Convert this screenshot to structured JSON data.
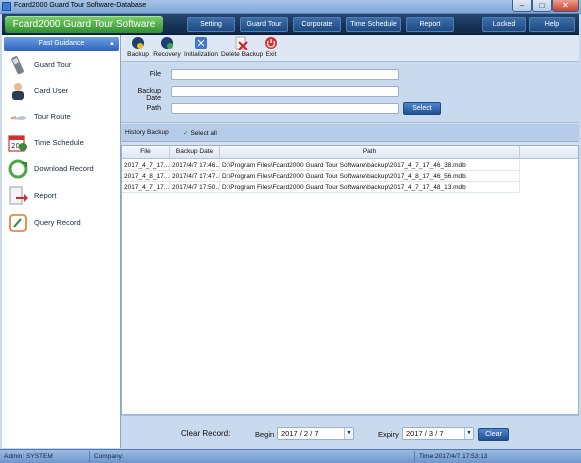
{
  "window": {
    "title": "Fcard2000 Guard Tour Software-Database"
  },
  "menubar": {
    "brand": "Fcard2000 Guard Tour Software",
    "items": [
      {
        "label": "Setting"
      },
      {
        "label": "Guard Tour"
      },
      {
        "label": "Corporate"
      },
      {
        "label": "Time Schedule"
      },
      {
        "label": "Report"
      },
      {
        "label": "Locked"
      },
      {
        "label": "Help"
      }
    ]
  },
  "sidebar": {
    "header": "Fast Guidance",
    "items": [
      {
        "label": "Guard Tour",
        "icon": "guard-tour-icon"
      },
      {
        "label": "Card User",
        "icon": "card-user-icon"
      },
      {
        "label": "Tour Route",
        "icon": "tour-route-icon"
      },
      {
        "label": "Time Schedule",
        "icon": "time-schedule-icon"
      },
      {
        "label": "Download Record",
        "icon": "download-record-icon"
      },
      {
        "label": "Report",
        "icon": "report-icon"
      },
      {
        "label": "Query Record",
        "icon": "query-record-icon"
      }
    ]
  },
  "toolbar": {
    "items": [
      {
        "label": "Backup",
        "icon": "backup-icon"
      },
      {
        "label": "Recovery",
        "icon": "recovery-icon"
      },
      {
        "label": "Initialization",
        "icon": "initialization-icon"
      },
      {
        "label": "Delete Backup",
        "icon": "delete-backup-icon"
      },
      {
        "label": "Exit",
        "icon": "exit-icon"
      }
    ]
  },
  "form": {
    "file_label": "File",
    "file_value": "",
    "backup_date_label": "Backup Date",
    "backup_date_value": "",
    "path_label": "Path",
    "path_value": "",
    "select_button": "Select"
  },
  "history": {
    "label": "History Backup",
    "select_all": "Select all",
    "columns": [
      "File",
      "Backup Date",
      "Path"
    ],
    "rows": [
      [
        "2017_4_7_17...",
        "2017/4/7 17:46...",
        "D:\\Program Files\\Fcard2000 Guard Tour Software\\backup\\2017_4_7_17_46_38.mdb"
      ],
      [
        "2017_4_8_17...",
        "2017/4/7 17:47...",
        "D:\\Program Files\\Fcard2000 Guard Tour Software\\backup\\2017_4_8_17_46_56.mdb"
      ],
      [
        "2017_4_7_17...",
        "2017/4/7 17:50...",
        "D:\\Program Files\\Fcard2000 Guard Tour Software\\backup\\2017_4_7_17_48_13.mdb"
      ]
    ]
  },
  "clear": {
    "label": "Clear Record:",
    "begin_label": "Begin",
    "begin_value": "2017 / 2 / 7",
    "expiry_label": "Expiry",
    "expiry_value": "2017 / 3 / 7",
    "button": "Clear"
  },
  "status": {
    "user": "Admin: SYSTEM",
    "company": "Company:",
    "time": "Time:2017/4/7 17:53:13"
  }
}
